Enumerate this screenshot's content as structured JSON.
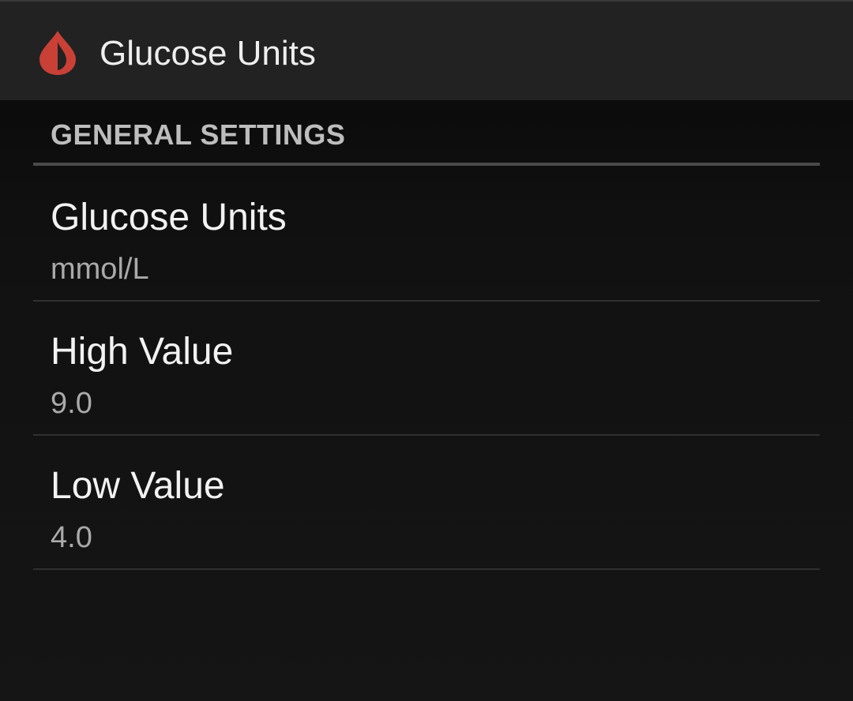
{
  "action_bar": {
    "title": "Glucose Units",
    "icon": "blood-drop-icon",
    "icon_color": "#c94037"
  },
  "section": {
    "header": "GENERAL SETTINGS"
  },
  "preferences": [
    {
      "title": "Glucose Units",
      "summary": "mmol/L"
    },
    {
      "title": "High Value",
      "summary": "9.0"
    },
    {
      "title": "Low Value",
      "summary": "4.0"
    }
  ],
  "colors": {
    "background": "#111111",
    "action_bar": "#222222",
    "accent": "#c94037"
  }
}
